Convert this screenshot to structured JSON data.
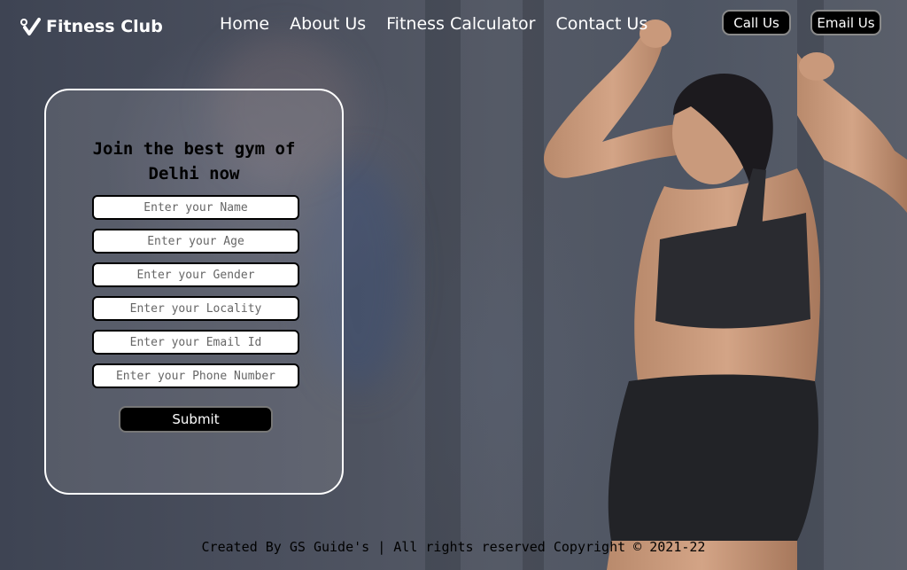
{
  "brand": {
    "name": "Fitness Club",
    "icon": "heart-check-icon"
  },
  "nav": {
    "items": [
      {
        "label": "Home"
      },
      {
        "label": "About Us"
      },
      {
        "label": "Fitness Calculator"
      },
      {
        "label": "Contact Us"
      }
    ]
  },
  "header_buttons": {
    "call": "Call Us",
    "email": "Email Us"
  },
  "form": {
    "title_line1": "Join the best gym of",
    "title_line2": "Delhi now",
    "fields": [
      {
        "placeholder": "Enter your Name",
        "value": ""
      },
      {
        "placeholder": "Enter your Age",
        "value": ""
      },
      {
        "placeholder": "Enter your Gender",
        "value": ""
      },
      {
        "placeholder": "Enter your Locality",
        "value": ""
      },
      {
        "placeholder": "Enter your Email Id",
        "value": ""
      },
      {
        "placeholder": "Enter your Phone Number",
        "value": ""
      }
    ],
    "submit_label": "Submit"
  },
  "footer": {
    "text": "Created By GS Guide's | All rights reserved Copyright © 2021-22"
  },
  "colors": {
    "accent": "#000000",
    "text_light": "#ffffff",
    "background": "#4a4f5d"
  }
}
